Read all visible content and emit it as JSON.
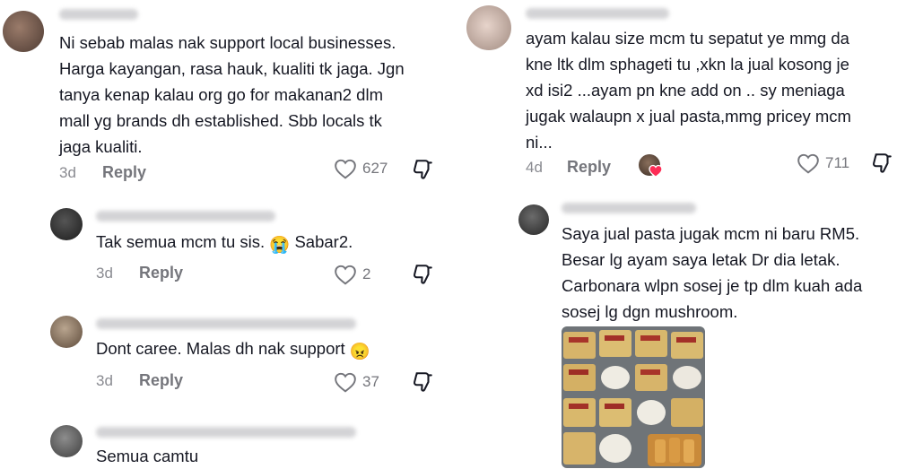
{
  "left": {
    "comments": [
      {
        "text": "Ni sebab malas nak support local businesses. Harga kayangan, rasa hauk, kualiti tk jaga. Jgn tanya kenap kalau org go for makanan2 dlm mall yg brands dh established. Sbb locals tk jaga kualiti.",
        "lines": [
          "Ni sebab malas nak support local businesses.",
          "Harga kayangan, rasa hauk, kualiti tk jaga. Jgn",
          "tanya kenap kalau org go for makanan2 dlm",
          "mall yg brands dh established. Sbb locals tk",
          "jaga kualiti."
        ],
        "age": "3d",
        "reply_label": "Reply",
        "likes": "627"
      },
      {
        "text": "Tak semua mcm tu sis. 😭 Sabar2.",
        "text_main": "Tak semua mcm tu sis.",
        "emoji": "😭",
        "text_tail": "Sabar2.",
        "age": "3d",
        "reply_label": "Reply",
        "likes": "2"
      },
      {
        "text": "Dont caree. Malas dh nak support 😠",
        "text_main": "Dont caree. Malas dh nak support",
        "emoji": "😠",
        "age": "3d",
        "reply_label": "Reply",
        "likes": "37"
      },
      {
        "text": "Semua camtu"
      }
    ]
  },
  "right": {
    "comments": [
      {
        "text": "ayam kalau size mcm tu sepatut ye mmg da kne ltk dlm sphageti tu ,xkn la jual kosong je xd isi2 ...ayam pn kne add on .. sy meniaga jugak walaupn x jual pasta,mmg pricey mcm ni...",
        "lines": [
          "ayam kalau size mcm tu sepatut ye mmg da",
          "kne ltk dlm sphageti tu ,xkn la jual kosong je",
          "xd isi2 ...ayam pn kne add on .. sy meniaga",
          "jugak walaupn x jual pasta,mmg pricey mcm",
          "ni..."
        ],
        "age": "4d",
        "reply_label": "Reply",
        "likes": "711"
      },
      {
        "text": "Saya jual pasta jugak mcm ni baru RM5. Besar lg ayam saya letak Dr dia letak. Carbonara wlpn sosej je tp dlm kuah ada sosej lg dgn mushroom.",
        "lines": [
          "Saya jual pasta jugak mcm ni baru RM5.",
          "Besar lg ayam saya letak Dr dia letak.",
          "Carbonara wlpn sosej je tp dlm kuah ada",
          "sosej lg dgn mushroom."
        ]
      }
    ]
  },
  "icons": {
    "like": "heart-outline-icon",
    "dislike": "thumbs-down-icon",
    "liked_by_creator": "creator-heart-avatar-icon"
  },
  "colors": {
    "text": "#161823",
    "meta": "#8a8b91",
    "reply": "#75767c",
    "creator_heart": "#fe2c55"
  }
}
